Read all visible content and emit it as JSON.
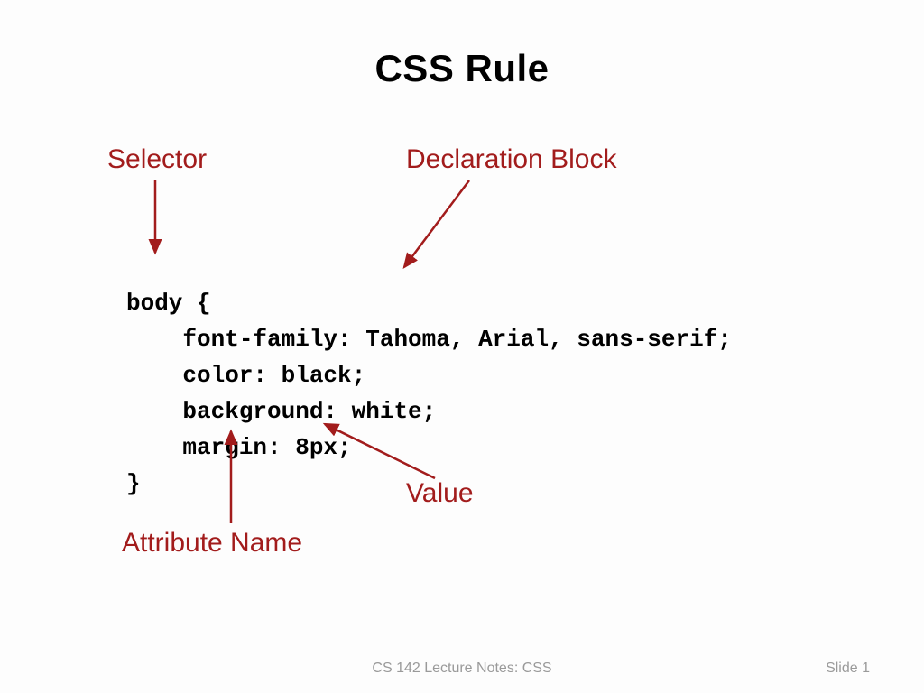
{
  "title": "CSS Rule",
  "labels": {
    "selector": "Selector",
    "declaration_block": "Declaration Block",
    "value": "Value",
    "attribute_name": "Attribute Name"
  },
  "code": "body {\n    font-family: Tahoma, Arial, sans-serif;\n    color: black;\n    background: white;\n    margin: 8px;\n}",
  "footer": {
    "notes": "CS 142 Lecture Notes: CSS",
    "slide": "Slide 1"
  },
  "arrow_color": "#a21c1c"
}
